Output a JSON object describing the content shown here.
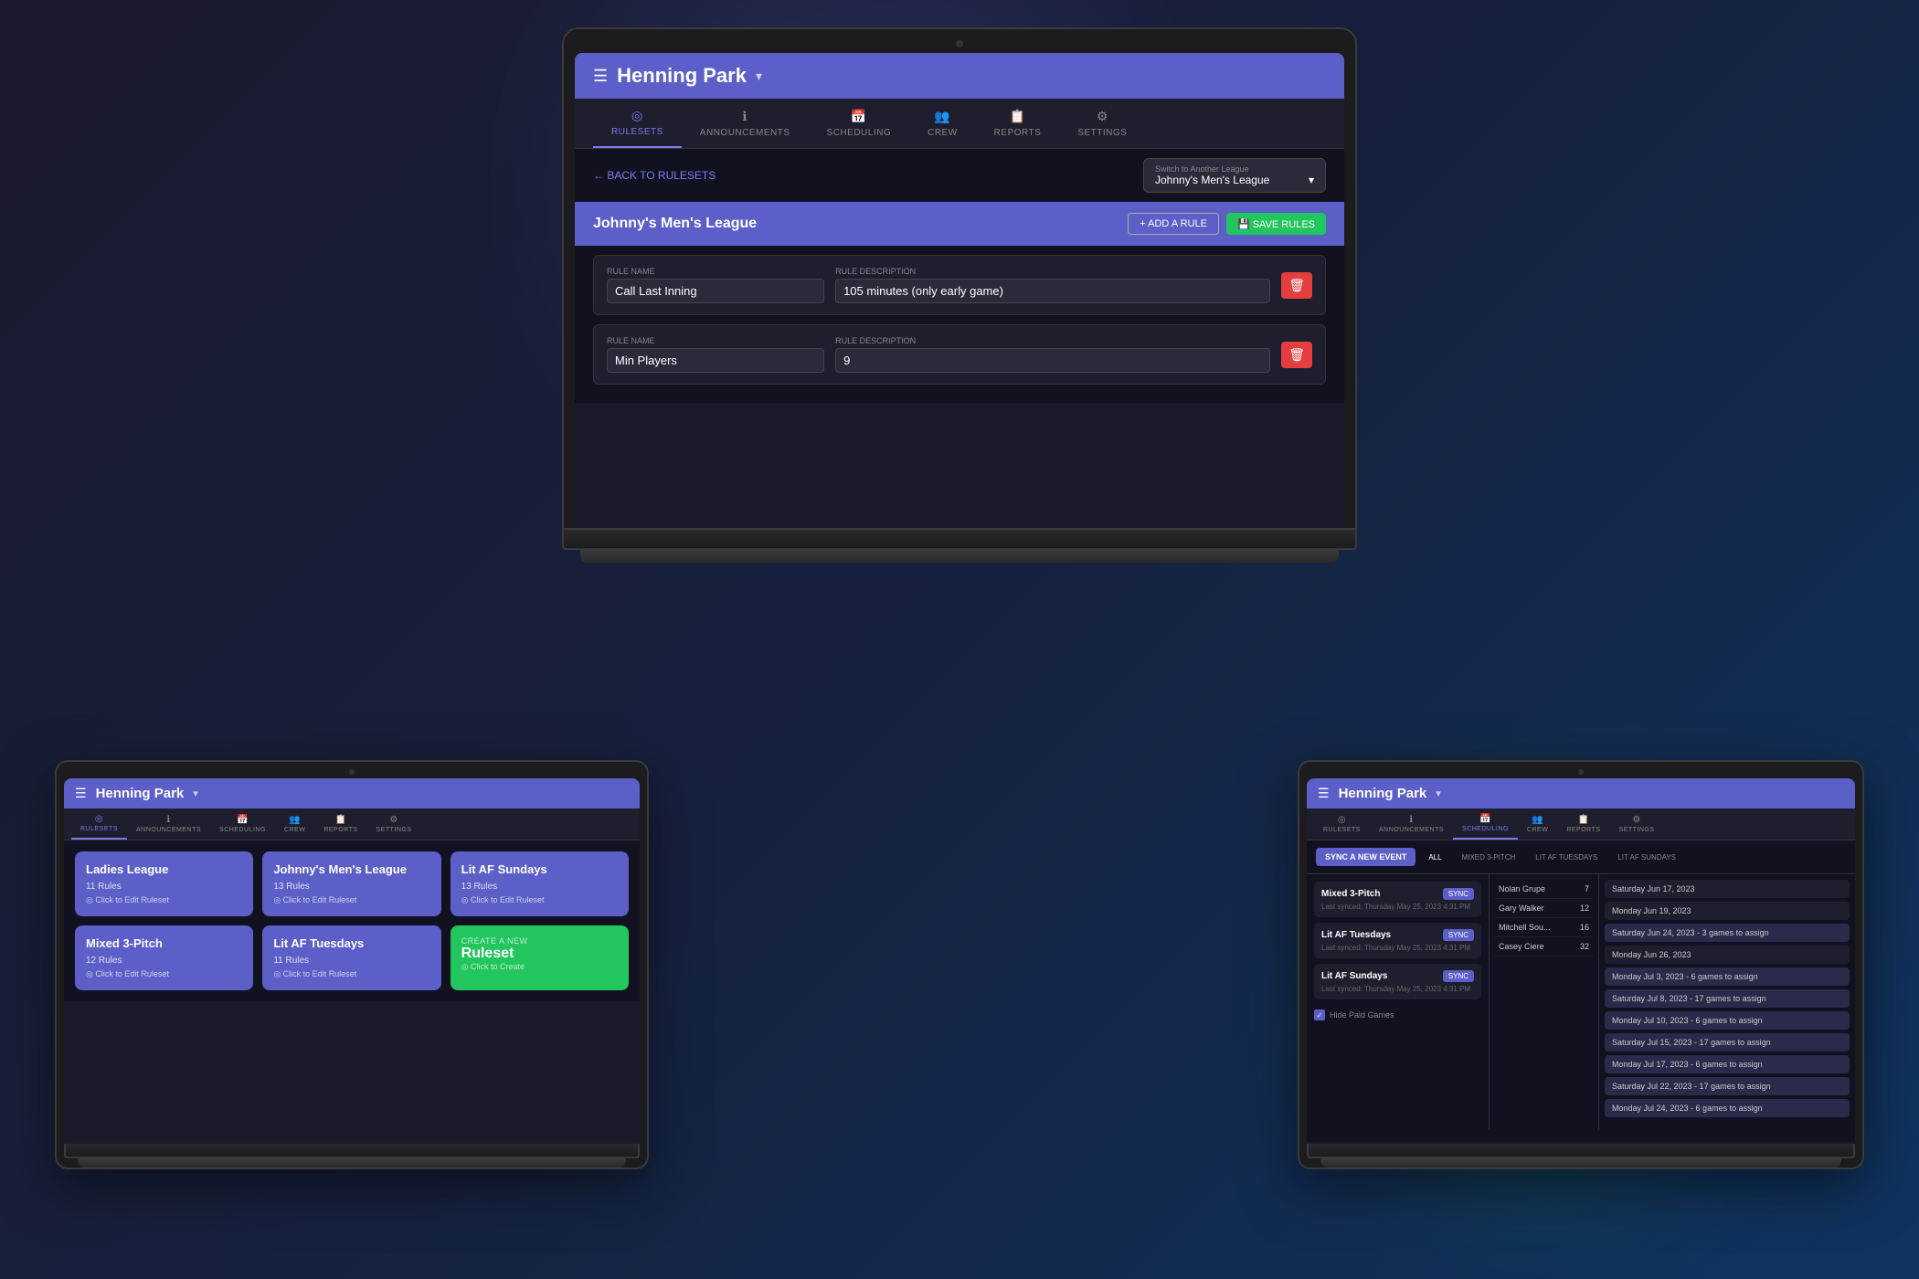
{
  "background": {
    "color": "#0f0f1a"
  },
  "laptop": {
    "header": {
      "park_name": "Henning Park",
      "chevron": "▾",
      "menu_icon": "☰"
    },
    "nav": {
      "tabs": [
        {
          "id": "rulesets",
          "label": "RULESETS",
          "icon": "◎",
          "active": true
        },
        {
          "id": "announcements",
          "label": "ANNOUNCEMENTS",
          "icon": "ℹ"
        },
        {
          "id": "scheduling",
          "label": "SCHEDULING",
          "icon": "📅"
        },
        {
          "id": "crew",
          "label": "CREW",
          "icon": "👥"
        },
        {
          "id": "reports",
          "label": "REPORTS",
          "icon": "📋"
        },
        {
          "id": "settings",
          "label": "SETTINGS",
          "icon": "⚙"
        }
      ]
    },
    "back_link": "← BACK TO RULESETS",
    "league_select": {
      "label": "Switch to Another League",
      "value": "Johnny's Men's League",
      "chevron": "▾"
    },
    "league_header": {
      "title": "Johnny's Men's League",
      "add_rule_btn": "+ ADD A RULE",
      "save_rules_btn": "💾 SAVE RULES"
    },
    "rules": [
      {
        "name_label": "Rule Name",
        "name_value": "Call Last Inning",
        "desc_label": "Rule Description",
        "desc_value": "105 minutes (only early game)"
      },
      {
        "name_label": "Rule Name",
        "name_value": "Min Players",
        "desc_label": "Rule Description",
        "desc_value": "9"
      }
    ]
  },
  "tablet_left": {
    "header": {
      "park_name": "Henning Park",
      "chevron": "▾",
      "menu_icon": "☰"
    },
    "nav": {
      "tabs": [
        {
          "id": "rulesets",
          "label": "RULESETS",
          "icon": "◎",
          "active": true
        },
        {
          "id": "announcements",
          "label": "ANNOUNCEMENTS",
          "icon": "ℹ"
        },
        {
          "id": "scheduling",
          "label": "SCHEDULING",
          "icon": "📅"
        },
        {
          "id": "crew",
          "label": "CREW",
          "icon": "👥"
        },
        {
          "id": "reports",
          "label": "REPORTS",
          "icon": "📋"
        },
        {
          "id": "settings",
          "label": "SETTINGS",
          "icon": "⚙"
        }
      ]
    },
    "rulesets": [
      {
        "title": "Ladies League",
        "rules": "11 Rules",
        "link": "Click to Edit Ruleset"
      },
      {
        "title": "Johnny's Men's League",
        "rules": "13 Rules",
        "link": "Click to Edit Ruleset"
      },
      {
        "title": "Lit AF Sundays",
        "rules": "13 Rules",
        "link": "Click to Edit Ruleset"
      },
      {
        "title": "Mixed 3-Pitch",
        "rules": "12 Rules",
        "link": "Click to Edit Ruleset"
      },
      {
        "title": "Lit AF Tuesdays",
        "rules": "11 Rules",
        "link": "Click to Edit Ruleset"
      },
      {
        "create_label": "CREATE A NEW",
        "create_title": "Ruleset",
        "create_link": "Click to Create"
      }
    ]
  },
  "tablet_right": {
    "header": {
      "park_name": "Henning Park",
      "chevron": "▾",
      "menu_icon": "☰"
    },
    "nav": {
      "tabs": [
        {
          "id": "rulesets",
          "label": "RULESETS",
          "icon": "◎"
        },
        {
          "id": "announcements",
          "label": "ANNOUNCEMENTS",
          "icon": "ℹ"
        },
        {
          "id": "scheduling",
          "label": "SCHEDULING",
          "icon": "📅",
          "active": true
        },
        {
          "id": "crew",
          "label": "CREW",
          "icon": "👥"
        },
        {
          "id": "reports",
          "label": "REPORTS",
          "icon": "📋"
        },
        {
          "id": "settings",
          "label": "SETTINGS",
          "icon": "⚙"
        }
      ]
    },
    "sync_new_btn": "SYNC A NEW EVENT",
    "filter_tabs": [
      {
        "label": "ALL",
        "active": true
      },
      {
        "label": "MIXED 3-PITCH"
      },
      {
        "label": "LIT AF TUESDAYS"
      },
      {
        "label": "LIT AF SUNDAYS"
      }
    ],
    "sync_items": [
      {
        "name": "Mixed 3-Pitch",
        "date": "Last synced: Thursday May 25, 2023 4:31 PM"
      },
      {
        "name": "Lit AF Tuesdays",
        "date": "Last synced: Thursday May 25, 2023 4:31 PM"
      },
      {
        "name": "Lit AF Sundays",
        "date": "Last synced: Thursday May 25, 2023 4:31 PM"
      }
    ],
    "hide_paid_label": "Hide Paid Games",
    "crew_items": [
      {
        "name": "Nolan Grupe",
        "num": "7"
      },
      {
        "name": "Gary Walker",
        "num": "12"
      },
      {
        "name": "Mitchell Sou...",
        "num": "16"
      },
      {
        "name": "Casey Ciere",
        "num": "32"
      }
    ],
    "dates": [
      {
        "label": "Saturday Jun 17, 2023"
      },
      {
        "label": "Monday Jun 19, 2023"
      },
      {
        "label": "Saturday Jun 24, 2023 - 3 games to assign"
      },
      {
        "label": "Monday Jun 26, 2023"
      },
      {
        "label": "Monday Jul 3, 2023 - 6 games to assign"
      },
      {
        "label": "Saturday Jul 8, 2023 - 17 games to assign"
      },
      {
        "label": "Monday Jul 10, 2023 - 6 games to assign"
      },
      {
        "label": "Saturday Jul 15, 2023 - 17 games to assign"
      },
      {
        "label": "Monday Jul 17, 2023 - 6 games to assign"
      },
      {
        "label": "Saturday Jul 22, 2023 - 17 games to assign"
      },
      {
        "label": "Monday Jul 24, 2023 - 6 games to assign"
      }
    ]
  }
}
